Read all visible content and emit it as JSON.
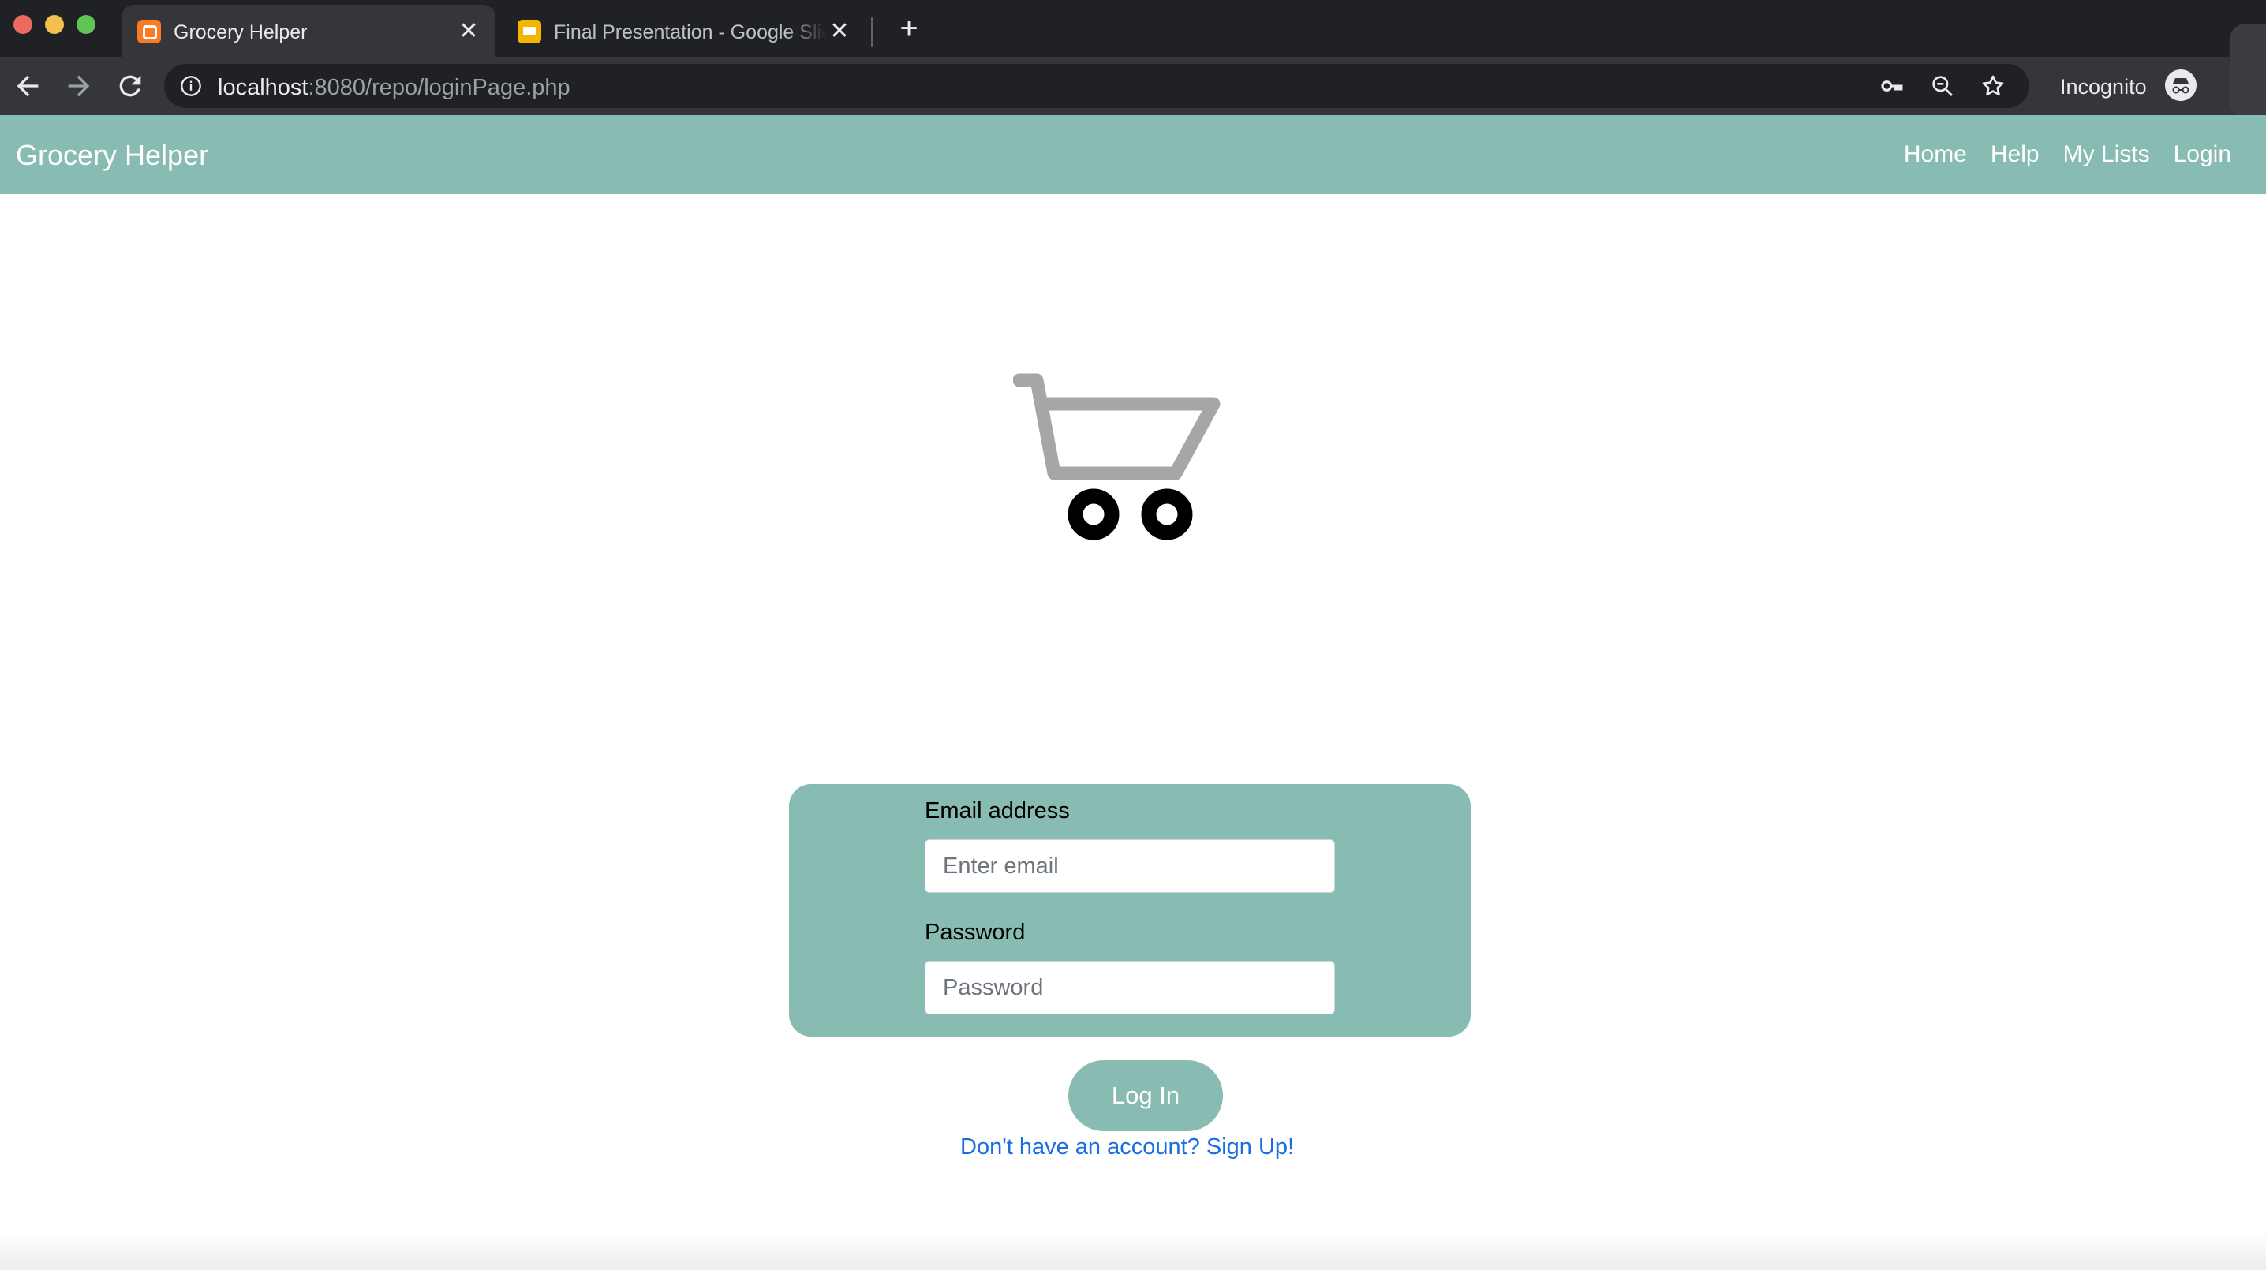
{
  "browser": {
    "tabs": [
      {
        "title": "Grocery Helper",
        "favicon": "xampp-icon",
        "active": true
      },
      {
        "title": "Final Presentation - Google Slides",
        "favicon": "slides-icon",
        "active": false
      }
    ],
    "url_host": "localhost",
    "url_path": ":8080/repo/loginPage.php",
    "incognito_label": "Incognito"
  },
  "navbar": {
    "brand": "Grocery Helper",
    "links": [
      "Home",
      "Help",
      "My Lists",
      "Login"
    ]
  },
  "hero": {
    "icon": "shopping-cart-icon"
  },
  "form": {
    "email_label": "Email address",
    "email_placeholder": "Enter email",
    "password_label": "Password",
    "password_placeholder": "Password",
    "submit_label": "Log In",
    "signup_text": "Don't have an account? Sign Up!"
  },
  "colors": {
    "accent": "#88bbb2",
    "link": "#1a6fe0",
    "chrome_dark": "#202124",
    "chrome_toolbar": "#35363a"
  }
}
